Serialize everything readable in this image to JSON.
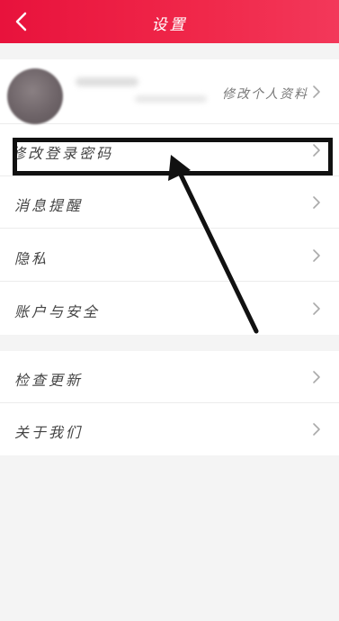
{
  "header": {
    "title": "设置",
    "back_icon": "chevron-left-icon",
    "background": "#ee1f44"
  },
  "profile": {
    "link_label": "修改个人资料"
  },
  "settings_group_1": [
    {
      "label": "修改登录密码"
    },
    {
      "label": "消息提醒"
    },
    {
      "label": "隐私"
    },
    {
      "label": "账户与安全"
    }
  ],
  "settings_group_2": [
    {
      "label": "检查更新"
    },
    {
      "label": "关于我们"
    }
  ],
  "icons": {
    "row_chevron": "chevron-right-icon"
  },
  "colors": {
    "accent": "#ee1f44",
    "annotation": "#111111"
  }
}
